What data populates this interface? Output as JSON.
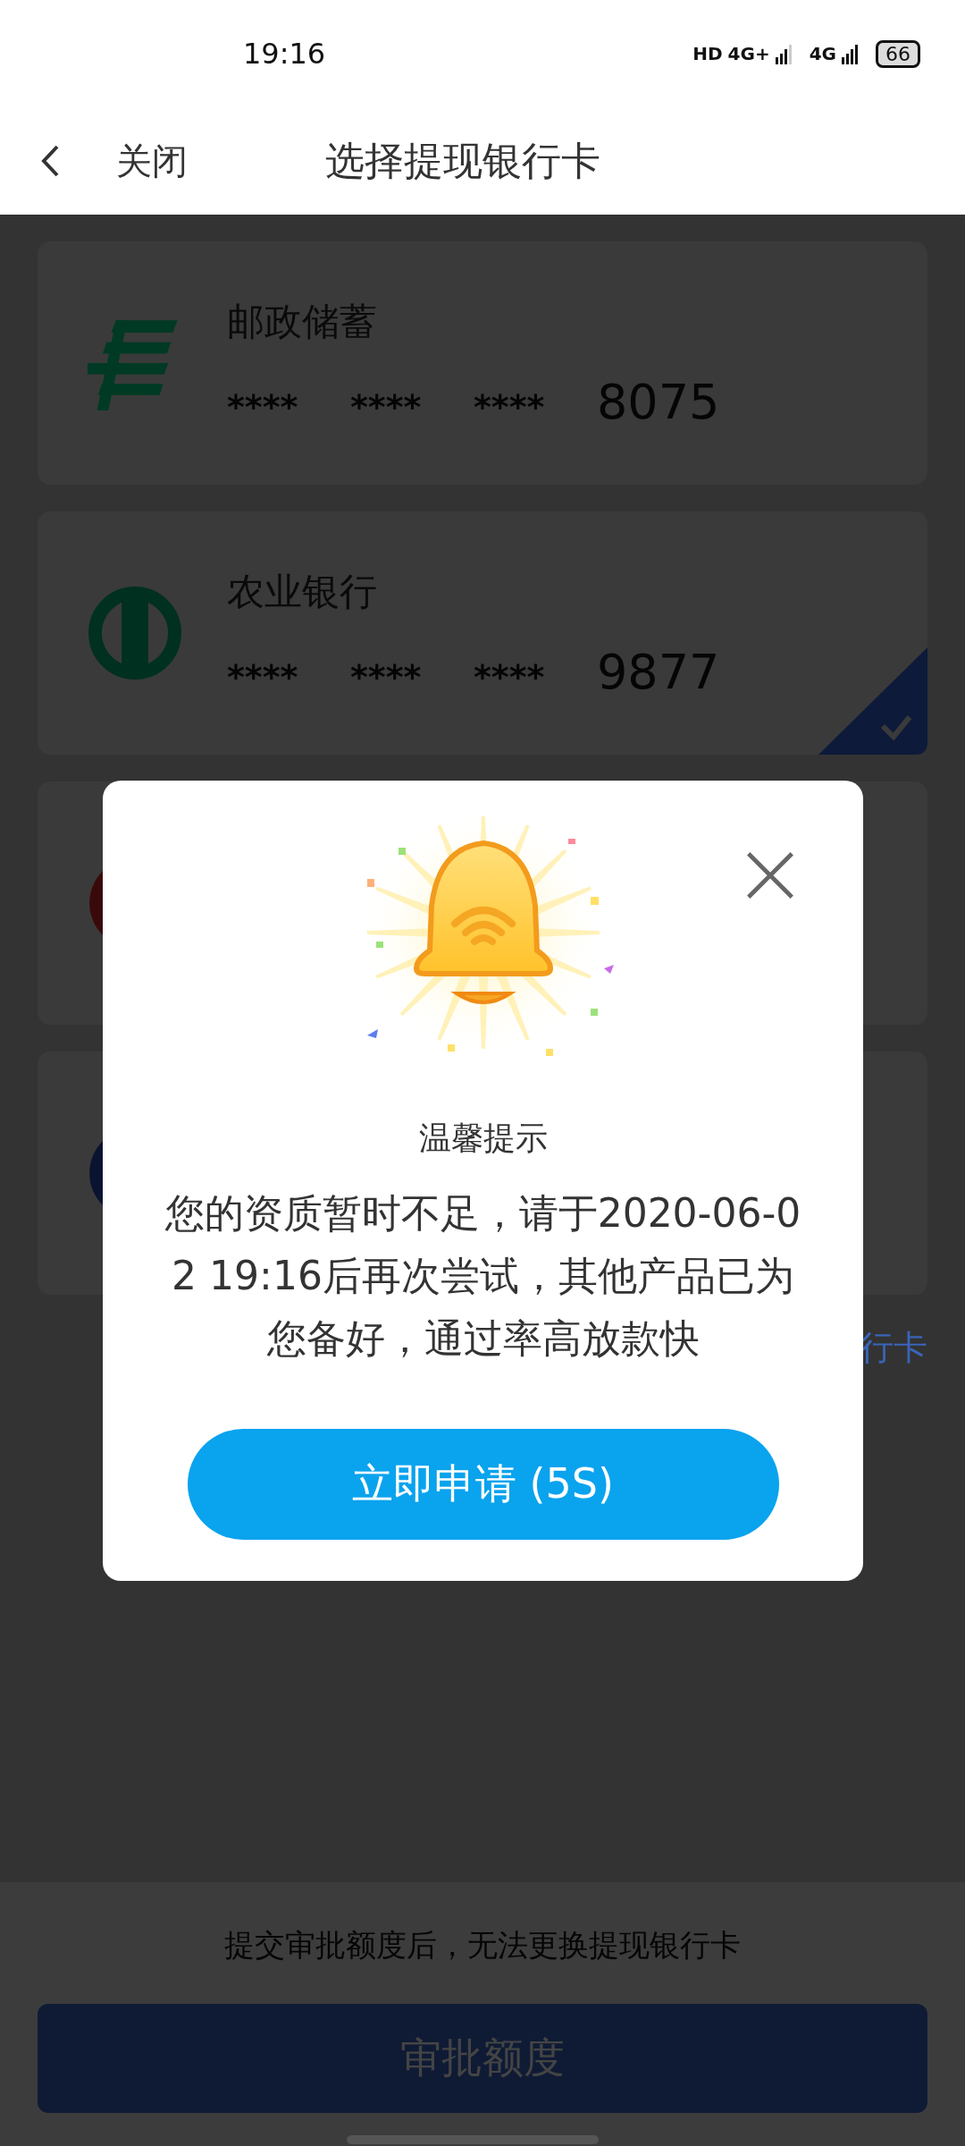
{
  "status_bar": {
    "time": "19:16",
    "network_labels": [
      "HD",
      "4G+",
      "4G"
    ],
    "battery": "66"
  },
  "header": {
    "back_label": "关闭",
    "title": "选择提现银行卡"
  },
  "cards": [
    {
      "kind": "postal",
      "bank": "邮政储蓄",
      "masked": [
        "****",
        "****",
        "****"
      ],
      "last4": "8075",
      "selected": false
    },
    {
      "kind": "agri",
      "bank": "农业银行",
      "masked": [
        "****",
        "****",
        "****"
      ],
      "last4": "9877",
      "selected": true
    },
    {
      "kind": "red",
      "selected": false
    },
    {
      "kind": "blue",
      "selected": false
    }
  ],
  "add_link": "行卡",
  "dialog": {
    "title": "温馨提示",
    "message": "您的资质暂时不足，请于2020-06-02 19:16后再次尝试，其他产品已为您备好，通过率高放款快",
    "button": "立即申请 (5S)"
  },
  "footer": {
    "note": "提交审批额度后，无法更换提现银行卡",
    "button": "审批额度"
  }
}
